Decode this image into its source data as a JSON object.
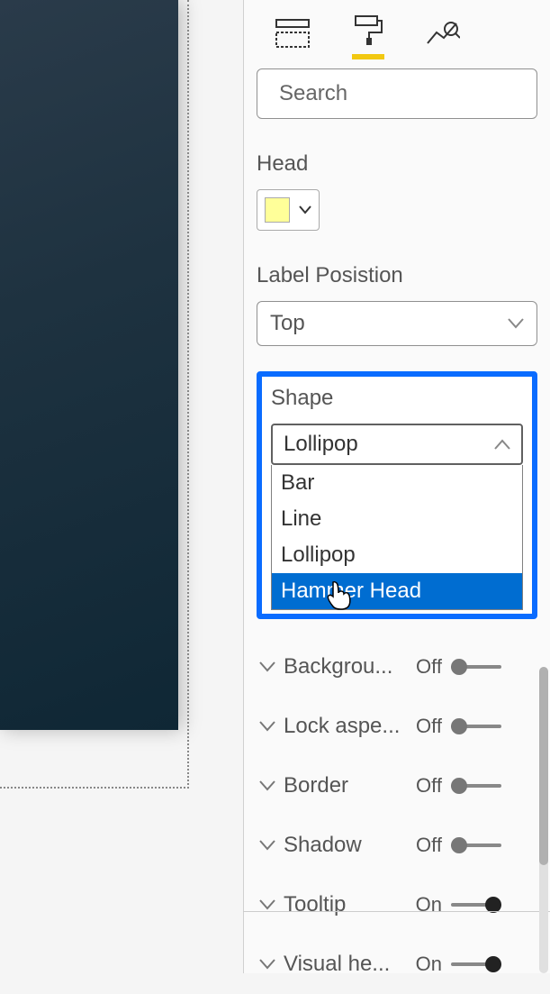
{
  "search": {
    "placeholder": "Search"
  },
  "head": {
    "label": "Head",
    "color": "#FFFF99"
  },
  "label_position": {
    "label": "Label Posistion",
    "value": "Top"
  },
  "shape": {
    "label": "Shape",
    "value": "Lollipop",
    "options": [
      "Bar",
      "Line",
      "Lollipop",
      "Hammer Head"
    ],
    "highlighted_index": 3
  },
  "props": [
    {
      "label": "Backgrou...",
      "value": "Off",
      "on": false
    },
    {
      "label": "Lock aspe...",
      "value": "Off",
      "on": false
    },
    {
      "label": "Border",
      "value": "Off",
      "on": false
    },
    {
      "label": "Shadow",
      "value": "Off",
      "on": false
    },
    {
      "label": "Tooltip",
      "value": "On",
      "on": true
    },
    {
      "label": "Visual he...",
      "value": "On",
      "on": true
    }
  ]
}
